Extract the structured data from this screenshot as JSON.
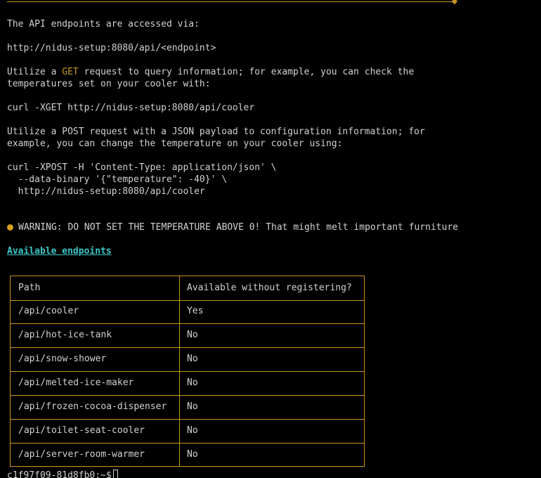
{
  "intro": {
    "line1": "The API endpoints are accessed via:",
    "base_url": "http://nidus-setup:8080/api/<endpoint>"
  },
  "get_section": {
    "prefix": "Utilize a ",
    "method": "GET",
    "suffix": " request to query information; for example, you can check the",
    "line2": "temperatures set on your cooler with:",
    "command": "curl -XGET http://nidus-setup:8080/api/cooler"
  },
  "post_section": {
    "line1": "Utilize a POST request with a JSON payload to configuration information; for",
    "line2": "example, you can change the temperature on your cooler using:",
    "cmd1": "curl -XPOST -H 'Content-Type: application/json' \\",
    "cmd2": "  --data-binary '{\"temperature\": -40}' \\",
    "cmd3": "  http://nidus-setup:8080/api/cooler"
  },
  "warning": {
    "text": "WARNING: DO NOT SET THE TEMPERATURE ABOVE 0! That might melt important furniture"
  },
  "endpoints": {
    "heading": "Available endpoints",
    "columns": [
      "Path",
      "Available without registering?"
    ],
    "rows": [
      [
        "/api/cooler",
        "Yes"
      ],
      [
        "/api/hot-ice-tank",
        "No"
      ],
      [
        "/api/snow-shower",
        "No"
      ],
      [
        "/api/melted-ice-maker",
        "No"
      ],
      [
        "/api/frozen-cocoa-dispenser",
        "No"
      ],
      [
        "/api/toilet-seat-cooler",
        "No"
      ],
      [
        "/api/server-room-warmer",
        "No"
      ]
    ]
  },
  "prompt": {
    "text": "c1f97f09-81d8fb0:~$"
  },
  "colors": {
    "background": "#000000",
    "text": "#d2d2d2",
    "border": "#c8961e",
    "heading": "#3ec6c6",
    "warning_dot": "#d4a017"
  }
}
